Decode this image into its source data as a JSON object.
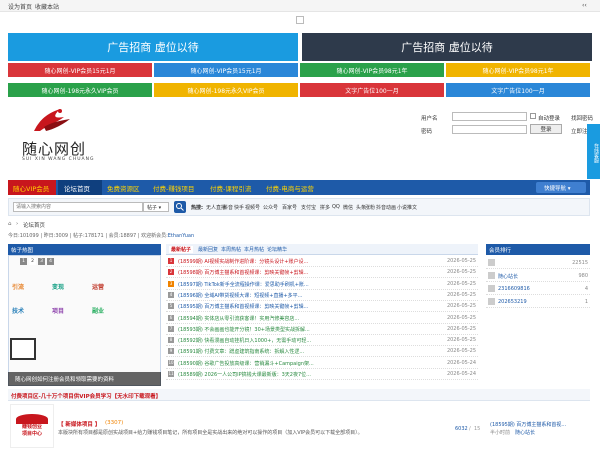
{
  "topbar": {
    "home": "设为首页",
    "fav": "收藏本站",
    "collapse": "‹‹"
  },
  "ads_big": [
    {
      "label": "广告招商 虚位以待",
      "color": "#1a9be0"
    },
    {
      "label": "广告招商 虚位以待",
      "color": "#2e3a4b"
    }
  ],
  "ads_row1": [
    {
      "label": "随心网创-VIP会员15元1月",
      "color": "#d9353a"
    },
    {
      "label": "随心网创-VIP会员15元1月",
      "color": "#2a87d8"
    },
    {
      "label": "随心网创-VIP会员98元1年",
      "color": "#2aa14a"
    },
    {
      "label": "随心网创-VIP会员98元1年",
      "color": "#f0b400"
    }
  ],
  "ads_row2": [
    {
      "label": "随心网创-198元永久VIP会员",
      "color": "#2aa14a"
    },
    {
      "label": "随心网创-198元永久VIP会员",
      "color": "#f0b400"
    },
    {
      "label": "文字广告位100一月",
      "color": "#d9353a"
    },
    {
      "label": "文字广告位100一月",
      "color": "#2a87d8"
    }
  ],
  "logo": {
    "cn": "随心网创",
    "pinyin": "SUI XIN WANG CHUANG"
  },
  "login": {
    "user_label": "用户名",
    "pass_label": "密码",
    "auto": "自动登录",
    "find": "找回密码",
    "login_btn": "登录",
    "register": "立即注册",
    "side_tab": "在线客服"
  },
  "nav": {
    "items": [
      "随心VIP会员",
      "论坛首页",
      "免费资源区",
      "付费-赚钱项目",
      "付费-课程引流",
      "付费-电商与运营"
    ],
    "quick": "快捷导航 ▾"
  },
  "search": {
    "placeholder": "请输入搜索内容",
    "scope": "帖子 ▾",
    "hot_label": "热搜:",
    "hot": [
      "无人直播",
      "抖音",
      "快手",
      "视频号",
      "公众号",
      "百家号",
      "支付宝",
      "拼多",
      "QQ",
      "微信",
      "头条",
      "涨粉",
      "抖音动画",
      "小说推文"
    ]
  },
  "breadcrumb": {
    "home": "⌂",
    "sep": "›",
    "label": "论坛首页"
  },
  "stats": {
    "today_label": "今日:",
    "today": "101099",
    "yesterday_label": "昨日:",
    "yesterday": "3009",
    "posts_label": "帖子:",
    "posts": "178171",
    "members_label": "会员:",
    "members": "18897",
    "welcome": "欢迎新会员:",
    "newuser": "EthanYuan"
  },
  "slider": {
    "title": "帖子热图",
    "pages": [
      "1",
      "2",
      "3",
      "4"
    ],
    "caption": "随心网创如何注册会员和领取需要的资料",
    "tiles": [
      "引流",
      "变现",
      "运营",
      "技术",
      "项目",
      "副业"
    ]
  },
  "tabs": [
    "最新帖子",
    "最新回复",
    "本周热帖",
    "本月热帖",
    "论坛精华"
  ],
  "threads": [
    {
      "t": "(18599期) AI视频实战制作进阶课：分镜头设计+账户设...",
      "d": "2026-05-25",
      "c": "#d9353a"
    },
    {
      "t": "(18598期) 百万博主猫系和首视频课：剪映关键帧+剪辑...",
      "d": "2026-05-25",
      "c": "#d9353a"
    },
    {
      "t": "(18597期) TikTok新手全流程操作课：爱思助手刷机+账...",
      "d": "2026-05-25",
      "c": "#f08300"
    },
    {
      "t": "(18596期) 全域AI带货视频大课：短视频+直播+多平...",
      "d": "2026-05-25",
      "c": "#999"
    },
    {
      "t": "(18595期) 百万博主猫系和首视频课：剪映关键帧+剪辑...",
      "d": "2026-05-25",
      "c": "#999"
    },
    {
      "t": "(18594期) 实体店从零引流获客课！实用汽修美容店...",
      "d": "2026-05-25",
      "c": "#999"
    },
    {
      "t": "(18593期) 不会画画也能开分镜！30+场景类型实战拆解...",
      "d": "2026-05-25",
      "c": "#999"
    },
    {
      "t": "(18592期) 快看漫画自动挂机日入1000+，无需手动可轻...",
      "d": "2026-05-25",
      "c": "#999"
    },
    {
      "t": "(18591期) 付费文章：蹭虚建筑指南系统：拆解入性逻...",
      "d": "2026-05-25",
      "c": "#999"
    },
    {
      "t": "(18590期) 谷歌广告投放高级课：营销漏斗+Campaign架...",
      "d": "2026-05-24",
      "c": "#999"
    },
    {
      "t": "(18589期) 2026一人公司IP搞钱大课最新版：3天2夜7位...",
      "d": "2026-05-24",
      "c": "#999"
    }
  ],
  "ranking": {
    "title": "会员排行",
    "rows": [
      {
        "name": "",
        "val": "22515"
      },
      {
        "name": "随心站长",
        "val": "980"
      },
      {
        "name": "2316609816",
        "val": "4"
      },
      {
        "name": "202653219",
        "val": "1"
      }
    ]
  },
  "section": {
    "title": "付费项目区-几十万个项目供VIP会员学习【无水印下载观看】",
    "item_title": "【 新媒体项目 】",
    "item_count": "(3307)",
    "item_desc": "本版块所有项目都是原创实战项目+给力赚钱项目笔记，所有项目全是实战出来的绝对可以操作的项目（加入VIP会员可以下载全部项目）。",
    "count": "6032",
    "sep": "/",
    "total": "15",
    "last_title": "(18595期) 百万博主猫系和首视...",
    "last_time": "半小时前",
    "last_user": "随心站长",
    "badge": "赚钱创业\n项目中心"
  }
}
